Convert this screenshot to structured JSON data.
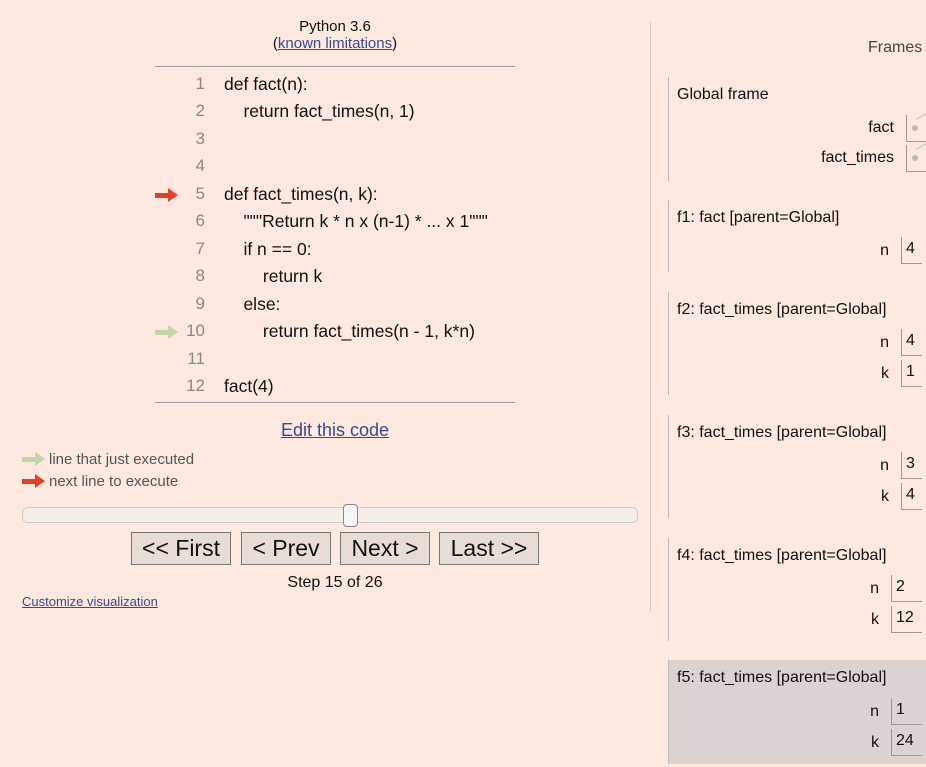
{
  "header": {
    "language": "Python 3.6",
    "open_paren": "(",
    "limitations_link": "known limitations",
    "close_paren": ")"
  },
  "code": {
    "lines": [
      {
        "no": "1",
        "text": "def fact(n):"
      },
      {
        "no": "2",
        "text": "    return fact_times(n, 1)"
      },
      {
        "no": "3",
        "text": ""
      },
      {
        "no": "4",
        "text": ""
      },
      {
        "no": "5",
        "text": "def fact_times(n, k):"
      },
      {
        "no": "6",
        "text": "    \"\"\"Return k * n x (n-1) * ... x 1\"\"\""
      },
      {
        "no": "7",
        "text": "    if n == 0:"
      },
      {
        "no": "8",
        "text": "        return k"
      },
      {
        "no": "9",
        "text": "    else:"
      },
      {
        "no": "10",
        "text": "        return fact_times(n - 1, k*n)"
      },
      {
        "no": "11",
        "text": ""
      },
      {
        "no": "12",
        "text": "fact(4)"
      }
    ],
    "next_line": "5",
    "just_executed_line": "10"
  },
  "edit_link": "Edit this code",
  "legend": {
    "executed": "line that just executed",
    "next": "next line to execute"
  },
  "navigation": {
    "first": "<< First",
    "prev": "< Prev",
    "next": "Next >",
    "last": "Last >>",
    "step_text": "Step 15 of 26",
    "current_step": 15,
    "total_steps": 26
  },
  "customize_link": "Customize visualization",
  "frames_panel": {
    "title": "Frames",
    "global": {
      "name": "Global frame",
      "vars": [
        "fact",
        "fact_times"
      ]
    },
    "frames": [
      {
        "name": "f1: fact [parent=Global]",
        "vars": [
          {
            "name": "n",
            "value": "4"
          }
        ]
      },
      {
        "name": "f2: fact_times [parent=Global]",
        "vars": [
          {
            "name": "n",
            "value": "4"
          },
          {
            "name": "k",
            "value": "1"
          }
        ]
      },
      {
        "name": "f3: fact_times [parent=Global]",
        "vars": [
          {
            "name": "n",
            "value": "3"
          },
          {
            "name": "k",
            "value": "4"
          }
        ]
      },
      {
        "name": "f4: fact_times [parent=Global]",
        "vars": [
          {
            "name": "n",
            "value": "2"
          },
          {
            "name": "k",
            "value": "12"
          }
        ]
      },
      {
        "name": "f5: fact_times [parent=Global]",
        "vars": [
          {
            "name": "n",
            "value": "1"
          },
          {
            "name": "k",
            "value": "24"
          }
        ]
      }
    ]
  },
  "colors": {
    "background": "#fde9df",
    "next_arrow": "#e4412b",
    "executed_arrow": "#c6d5a9",
    "active_frame": "#dcd3d0",
    "link": "#3a4a8c"
  }
}
